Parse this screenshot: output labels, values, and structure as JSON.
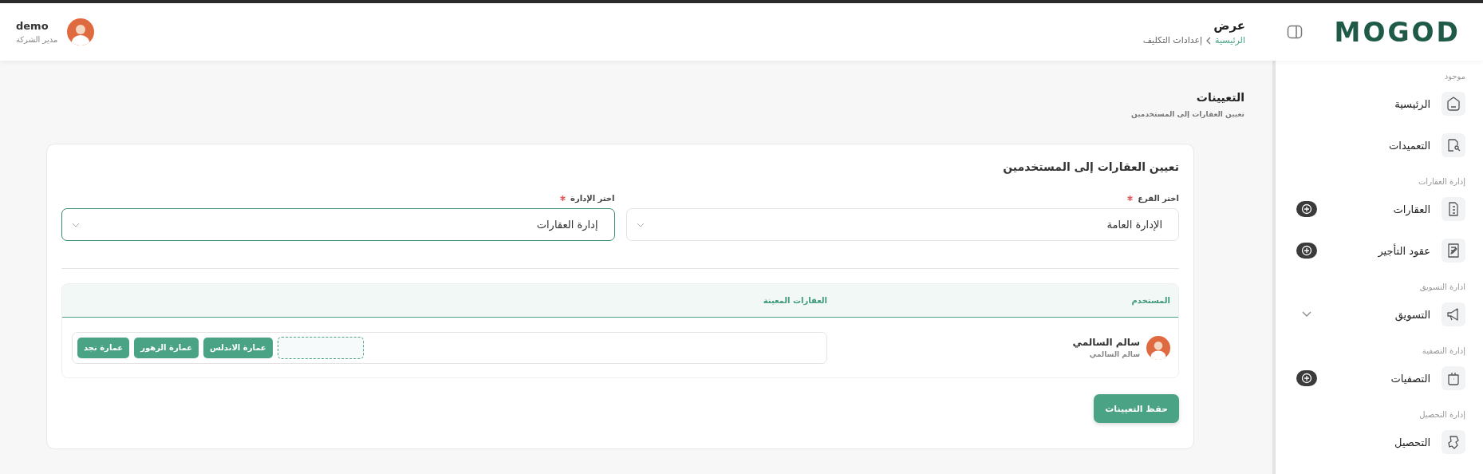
{
  "header": {
    "logo": "MOGOD",
    "page_title": "عرض",
    "breadcrumb": [
      {
        "label": "الرئيسية",
        "link": true
      },
      {
        "label": "إعدادات التكليف",
        "link": false
      }
    ],
    "user": {
      "name": "demo",
      "role": "مدير الشركة"
    }
  },
  "sidebar": {
    "sections": [
      {
        "title": "موجود",
        "items": [
          {
            "label": "الرئيسية",
            "add": false,
            "expandable": false
          },
          {
            "label": "التعميدات",
            "add": false,
            "expandable": false
          }
        ]
      },
      {
        "title": "إدارة العقارات",
        "items": [
          {
            "label": "العقارات",
            "add": true,
            "expandable": false
          },
          {
            "label": "عقود التأجير",
            "add": true,
            "expandable": false
          }
        ]
      },
      {
        "title": "ادارة التسويق",
        "items": [
          {
            "label": "التسويق",
            "add": false,
            "expandable": true
          }
        ]
      },
      {
        "title": "إدارة التصفية",
        "items": [
          {
            "label": "التصفيات",
            "add": true,
            "expandable": false
          }
        ]
      },
      {
        "title": "إدارة التحصيل",
        "items": [
          {
            "label": "التحصيل",
            "add": false,
            "expandable": false
          }
        ]
      }
    ]
  },
  "page": {
    "title": "التعيينات",
    "subtitle": "تعيين العقارات إلى المستخدمين"
  },
  "card": {
    "title": "تعيين العقارات إلى المستخدمين",
    "fields": [
      {
        "label": "اختر الفرع",
        "required": true,
        "value": "الإدارة العامة",
        "focused": false
      },
      {
        "label": "اختر الإدارة",
        "required": true,
        "value": "إدارة العقارات",
        "focused": true
      }
    ],
    "table": {
      "columns": [
        "المستخدم",
        "العقارات المعينة"
      ],
      "rows": [
        {
          "name": "سالم السالمي",
          "subtitle": "سالم السالمي",
          "tags": [
            "عمارة الاندلس",
            "عمارة الزهور",
            "عمارة نجد"
          ]
        }
      ]
    },
    "save_button": "حفظ التعيينات"
  }
}
